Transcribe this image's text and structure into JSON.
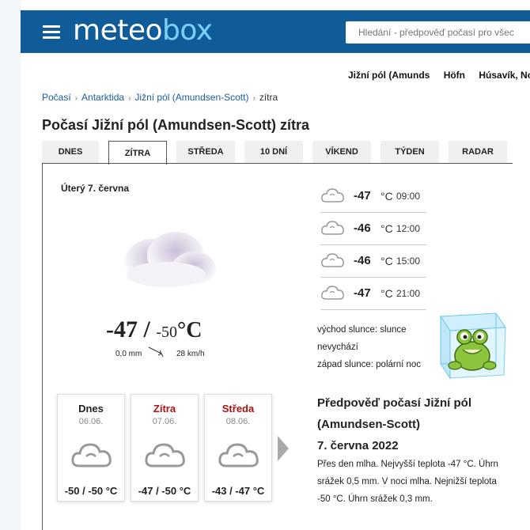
{
  "header": {
    "logo_part1": "meteo",
    "logo_part2": "box",
    "search_placeholder": "Hledání - předpověď počasí pro všec"
  },
  "quicklinks": [
    "Jižní pól (Amunds",
    "Höfn",
    "Húsavík, Nort"
  ],
  "breadcrumb": [
    "Počasí",
    "Antarktida",
    "Jižní pól (Amundsen-Scott)",
    "zítra"
  ],
  "page_title": "Počasí Jižní pól (Amundsen-Scott) zítra",
  "tabs": [
    "DNES",
    "ZÍTRA",
    "STŘEDA",
    "10 DNÍ",
    "VÍKEND",
    "TÝDEN",
    "RADAR"
  ],
  "active_tab": "ZÍTRA",
  "main": {
    "date": "Úterý 7. června",
    "temp_max": "-47",
    "slash": " / ",
    "temp_min": "-50",
    "unit": "°C",
    "precip": "0,0 mm",
    "wind": "28 km/h",
    "icon": "cloud-icon"
  },
  "hourly": [
    {
      "temp": "-47",
      "unit": "°C",
      "time": "09:00",
      "icon": "cloud-icon"
    },
    {
      "temp": "-46",
      "unit": "°C",
      "time": "12:00",
      "icon": "cloud-icon"
    },
    {
      "temp": "-46",
      "unit": "°C",
      "time": "15:00",
      "icon": "cloud-icon"
    },
    {
      "temp": "-47",
      "unit": "°C",
      "time": "21:00",
      "icon": "cloud-icon"
    }
  ],
  "sun": {
    "sunrise": "východ slunce: slunce nevychází",
    "sunset": "západ slunce: polární noc"
  },
  "cards": [
    {
      "day": "Dnes",
      "date": "06.06.",
      "temps": "-50 / -50 °C",
      "color": "#111111"
    },
    {
      "day": "Zítra",
      "date": "07.06.",
      "temps": "-47 / -50 °C",
      "color": "#aa1111"
    },
    {
      "day": "Středa",
      "date": "08.06.",
      "temps": "-43 / -47 °C",
      "color": "#aa1111"
    }
  ],
  "forecast": {
    "title": "Předpověď počasí Jižní pól (Amundsen-Scott)",
    "subtitle": "7. června 2022",
    "text": "Přes den mlha. Nejvyšší teplota -47 °C. Úhrn srážek 0,5 mm. V noci mlha. Nejnižší teplota -50 °C. Úhrn srážek 0,3 mm."
  },
  "colors": {
    "header_bg": "#0f5c99",
    "link": "#1a5fa0",
    "accent_red": "#aa1111"
  }
}
